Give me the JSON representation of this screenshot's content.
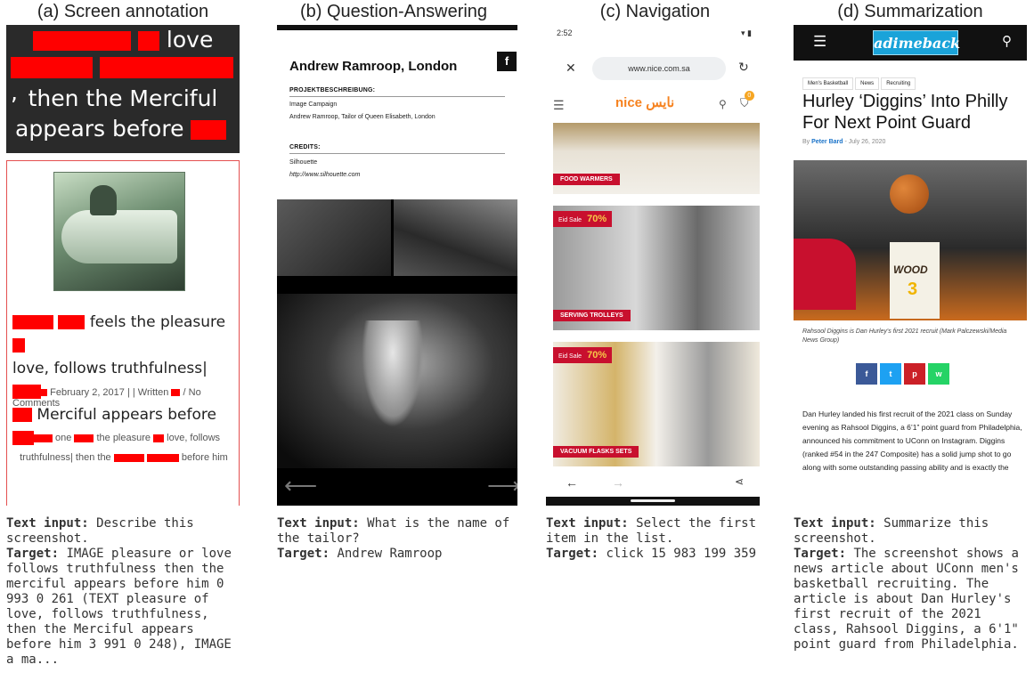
{
  "panels": {
    "a": {
      "title": "(a) Screen annotation",
      "quote": {
        "line1_word": "love",
        "line2_end": ",",
        "line3": "then the Merciful",
        "line4": "appears before"
      },
      "headline": {
        "l1_word": "feels the pleasure",
        "l2": "love, follows truthfulness",
        "l3": "Merciful appears before"
      },
      "meta": "February 2, 2017 | | Written",
      "meta_tail": "/ No Comments",
      "excerpt": {
        "w1": "one",
        "w2": "the pleasure",
        "w3": "love, follows",
        "w4": "truthfulness",
        "w5": "then the",
        "w6": "before him"
      },
      "caption_label1": "Text input:",
      "caption_text1": " Describe this screenshot.",
      "caption_label2": "Target:",
      "caption_text2": " IMAGE pleasure or love follows truthfulness then the merciful appears before him 0 993 0 261 (TEXT pleasure of love, follows truthfulness, then the Merciful appears before him 3 991 0 248), IMAGE a ma..."
    },
    "b": {
      "title": "(b) Question-Answering",
      "fb_icon": "f",
      "name": "Andrew Ramroop, London",
      "section1": "PROJEKTBESCHREIBUNG:",
      "line1": "Image Campaign",
      "line2": "Andrew Ramroop, Tailor of Queen Elisabeth, London",
      "section2": "CREDITS:",
      "line3": "Silhouette",
      "line4": "http://www.silhouette.com",
      "arrow_left": "⟵",
      "arrow_right": "⟶",
      "caption_label1": "Text input:",
      "caption_text1": " What is the name of the tailor?",
      "caption_label2": "Target:",
      "caption_text2": " Andrew Ramroop"
    },
    "c": {
      "title": "(c) Navigation",
      "status_time": "2:52",
      "status_right": "▾ ▮",
      "url": "www.nice.com.sa",
      "logo": "nice نايس",
      "cart_count": "0",
      "tiles": [
        {
          "label": "FOOD WARMERS",
          "sale": ""
        },
        {
          "label": "SERVING TROLLEYS",
          "sale": "Eid Sale",
          "pct": "70%"
        },
        {
          "label": "VACUUM FLASKS SETS",
          "sale": "Eid Sale",
          "pct": "70%"
        }
      ],
      "caption_label1": "Text input:",
      "caption_text1": " Select the first item in the list.",
      "caption_label2": "Target:",
      "caption_text2": " click 15 983 199 359"
    },
    "d": {
      "title": "(d) Summarization",
      "brand": "adimeback",
      "tags": [
        "Men's Basketball",
        "News",
        "Recruiting"
      ],
      "headline": "Hurley ‘Diggins’ Into Philly For Next Point Guard",
      "by": "By",
      "author": "Peter Bard",
      "date": "- July 26, 2020",
      "jersey": "WOOD",
      "number": "3",
      "image_caption": "Rahsool Diggins is Dan Hurley's first 2021 recruit (Mark Palczewski/Media News Group)",
      "social": [
        {
          "icon": "f",
          "color": "#3b5998"
        },
        {
          "icon": "t",
          "color": "#1da1f2"
        },
        {
          "icon": "p",
          "color": "#cb2027"
        },
        {
          "icon": "w",
          "color": "#25d366"
        }
      ],
      "body": "Dan Hurley landed his first recruit of the 2021 class on Sunday evening as Rahsool Diggins, a 6’1” point guard from Philadelphia, announced his commitment to UConn on Instagram. Diggins (ranked #54 in the 247 Composite) has a solid jump shot to go along with some outstanding passing ability and is exactly the",
      "caption_label1": "Text input:",
      "caption_text1": " Summarize this screenshot.",
      "caption_label2": "Target:",
      "caption_text2": " The screenshot shows a news article about UConn men's basketball recruiting. The article is about Dan Hurley's first recruit of the 2021 class, Rahsool Diggins, a 6'1\" point guard from Philadelphia."
    }
  }
}
